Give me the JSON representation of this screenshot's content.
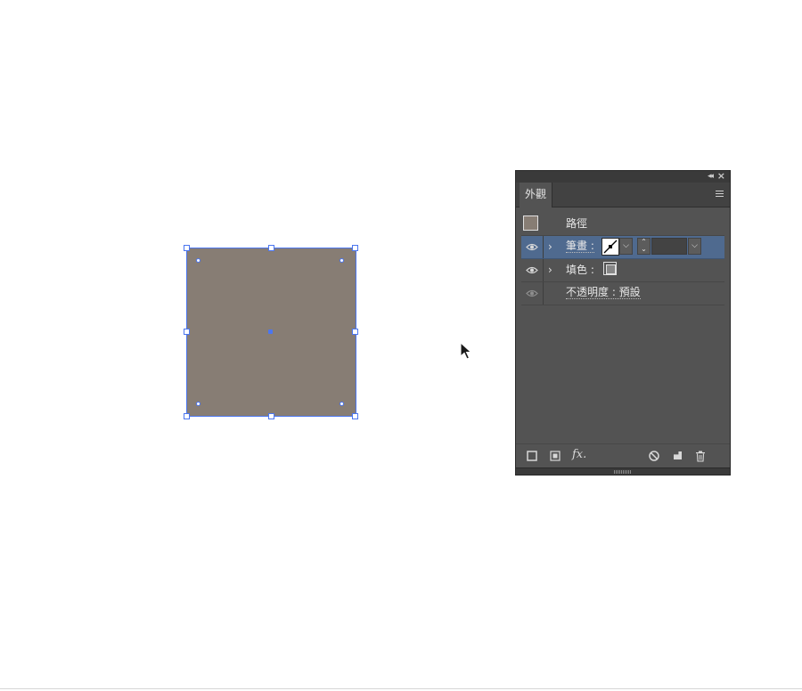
{
  "panel": {
    "tab_label": "外觀",
    "rows": {
      "path": {
        "label": "路徑"
      },
      "stroke": {
        "label": "筆畫 :",
        "weight_value": ""
      },
      "fill": {
        "label": "填色 :"
      },
      "opacity": {
        "label": "不透明度 : 預設"
      }
    }
  },
  "colors": {
    "object_fill": "#877d74",
    "selection": "#4b76f0",
    "panel_bg": "#535353",
    "selected_row": "#4f6a8f"
  },
  "icons": {
    "visibility": "eye-icon",
    "expand": "chevron-right-icon",
    "collapse_panel": "double-chevron-left-icon",
    "close": "close-icon",
    "menu": "hamburger-menu-icon",
    "add_stroke": "add-new-stroke-icon",
    "add_fill": "add-new-fill-icon",
    "fx": "add-effect-icon",
    "clear": "clear-appearance-icon",
    "duplicate": "duplicate-item-icon",
    "delete": "trash-icon"
  }
}
